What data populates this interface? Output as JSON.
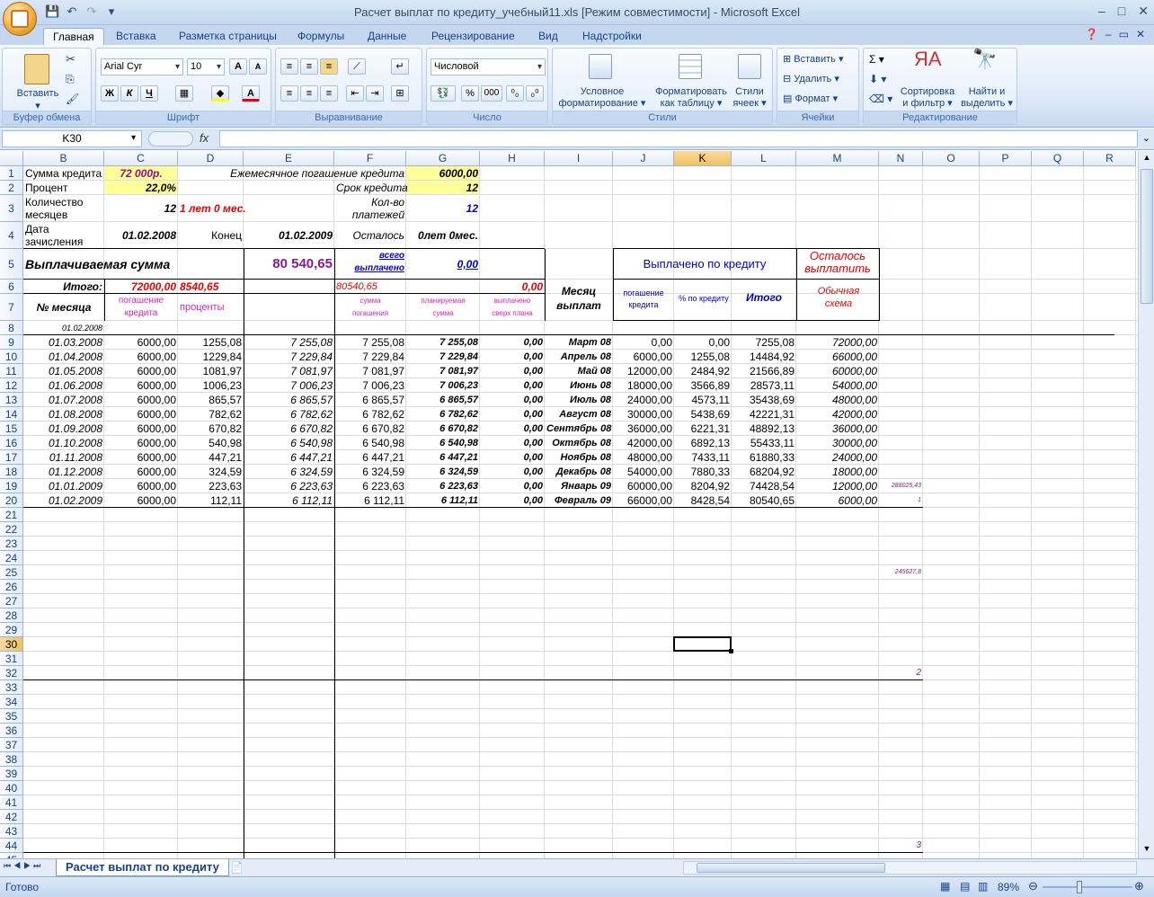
{
  "window": {
    "title": "Расчет выплат по кредиту_учебный11.xls  [Режим совместимости] - Microsoft Excel",
    "min": "–",
    "max": "□",
    "close": "✕"
  },
  "tabs": [
    "Главная",
    "Вставка",
    "Разметка страницы",
    "Формулы",
    "Данные",
    "Рецензирование",
    "Вид",
    "Надстройки"
  ],
  "ribbon": {
    "clipboard": {
      "label": "Буфер обмена",
      "paste": "Вставить"
    },
    "font": {
      "label": "Шрифт",
      "name": "Arial Cyr",
      "size": "10",
      "bold": "Ж",
      "italic": "К",
      "underline": "Ч"
    },
    "alignment": {
      "label": "Выравнивание"
    },
    "number": {
      "label": "Число",
      "format": "Числовой",
      "percent": "%",
      "thousands": "000"
    },
    "styles": {
      "label": "Стили",
      "cond1": "Условное",
      "cond2": "форматирование ▾",
      "table1": "Форматировать",
      "table2": "как таблицу ▾",
      "cell1": "Стили",
      "cell2": "ячеек ▾"
    },
    "cells": {
      "label": "Ячейки",
      "insert": "Вставить ▾",
      "delete": "Удалить ▾",
      "format": "Формат ▾"
    },
    "editing": {
      "label": "Редактирование",
      "sum": "Σ ▾",
      "sort1": "Сортировка",
      "sort2": "и фильтр ▾",
      "find1": "Найти и",
      "find2": "выделить ▾"
    }
  },
  "formula_bar": {
    "name_box": "K30",
    "fx": "fx",
    "value": ""
  },
  "columns": [
    "B",
    "C",
    "D",
    "E",
    "F",
    "G",
    "H",
    "I",
    "J",
    "K",
    "L",
    "M",
    "N",
    "O",
    "P",
    "Q",
    "R"
  ],
  "rows": [
    "1",
    "2",
    "3",
    "4",
    "5",
    "6",
    "7",
    "8",
    "9",
    "10",
    "11",
    "12",
    "13",
    "14",
    "15",
    "16",
    "17",
    "18",
    "19",
    "20",
    "21",
    "22",
    "23",
    "24",
    "25",
    "26",
    "27",
    "28",
    "29",
    "30",
    "31",
    "32",
    "33",
    "34",
    "35",
    "36",
    "37",
    "38",
    "39",
    "40",
    "41",
    "42",
    "43",
    "44",
    "45"
  ],
  "header": {
    "b1": "Сумма кредита",
    "c1": "72 000р.",
    "e1": "Ежемесячное погашение кредита",
    "g1": "6000,00",
    "b2": "Процент",
    "c2": "22,0%",
    "f2": "Срок кредита",
    "g2": "12",
    "b3a": "Количество",
    "b3b": "месяцев",
    "c3": "12",
    "d3": "1 лет 0 мес.",
    "f3a": "Кол-во",
    "f3b": "платежей",
    "g3": "12",
    "b4a": "Дата",
    "b4b": "зачисления",
    "c4": "01.02.2008",
    "d4": "Конец",
    "e4": "01.02.2009",
    "f4": "Осталось",
    "g4": "0лет 0мес.",
    "b5": "Выплачиваемая сумма",
    "e5": "80 540,65",
    "f5a": "всего",
    "f5b": "выплачено",
    "g5": "0,00",
    "j5": "Выплачено по кредиту",
    "m5a": "Осталось",
    "m5b": "выплатить",
    "b6": "Итого:",
    "c6": "72000,00",
    "d6": "8540,65",
    "f6": "80540,65",
    "h6": "0,00",
    "i6a": "Месяц",
    "i6b": "выплат",
    "j6a": "погашение",
    "j6b": "кредита",
    "k6": "% по кредиту",
    "l6": "Итого",
    "m6a": "Обычная",
    "m6b": "схема",
    "b7": "№ месяца",
    "c7a": "погашение",
    "c7b": "кредита",
    "d7": "проценты",
    "f7a": "сумма",
    "f7b": "погашения",
    "g7a": "планируемая",
    "g7b": "сумма",
    "h7a": "выплачено",
    "h7b": "сверх плана",
    "b8": "01.02.2008"
  },
  "table": [
    [
      "01.03.2008",
      "6000,00",
      "1255,08",
      "7 255,08",
      "7 255,08",
      "7 255,08",
      "0,00",
      "Март 08",
      "0,00",
      "0,00",
      "7255,08",
      "72000,00",
      ""
    ],
    [
      "01.04.2008",
      "6000,00",
      "1229,84",
      "7 229,84",
      "7 229,84",
      "7 229,84",
      "0,00",
      "Апрель 08",
      "6000,00",
      "1255,08",
      "14484,92",
      "66000,00",
      ""
    ],
    [
      "01.05.2008",
      "6000,00",
      "1081,97",
      "7 081,97",
      "7 081,97",
      "7 081,97",
      "0,00",
      "Май 08",
      "12000,00",
      "2484,92",
      "21566,89",
      "60000,00",
      ""
    ],
    [
      "01.06.2008",
      "6000,00",
      "1006,23",
      "7 006,23",
      "7 006,23",
      "7 006,23",
      "0,00",
      "Июнь 08",
      "18000,00",
      "3566,89",
      "28573,11",
      "54000,00",
      ""
    ],
    [
      "01.07.2008",
      "6000,00",
      "865,57",
      "6 865,57",
      "6 865,57",
      "6 865,57",
      "0,00",
      "Июль 08",
      "24000,00",
      "4573,11",
      "35438,69",
      "48000,00",
      ""
    ],
    [
      "01.08.2008",
      "6000,00",
      "782,62",
      "6 782,62",
      "6 782,62",
      "6 782,62",
      "0,00",
      "Август 08",
      "30000,00",
      "5438,69",
      "42221,31",
      "42000,00",
      ""
    ],
    [
      "01.09.2008",
      "6000,00",
      "670,82",
      "6 670,82",
      "6 670,82",
      "6 670,82",
      "0,00",
      "Сентябрь 08",
      "36000,00",
      "6221,31",
      "48892,13",
      "36000,00",
      ""
    ],
    [
      "01.10.2008",
      "6000,00",
      "540,98",
      "6 540,98",
      "6 540,98",
      "6 540,98",
      "0,00",
      "Октябрь 08",
      "42000,00",
      "6892,13",
      "55433,11",
      "30000,00",
      ""
    ],
    [
      "01.11.2008",
      "6000,00",
      "447,21",
      "6 447,21",
      "6 447,21",
      "6 447,21",
      "0,00",
      "Ноябрь 08",
      "48000,00",
      "7433,11",
      "61880,33",
      "24000,00",
      ""
    ],
    [
      "01.12.2008",
      "6000,00",
      "324,59",
      "6 324,59",
      "6 324,59",
      "6 324,59",
      "0,00",
      "Декабрь 08",
      "54000,00",
      "7880,33",
      "68204,92",
      "18000,00",
      ""
    ],
    [
      "01.01.2009",
      "6000,00",
      "223,63",
      "6 223,63",
      "6 223,63",
      "6 223,63",
      "0,00",
      "Январь 09",
      "60000,00",
      "8204,92",
      "74428,54",
      "12000,00",
      "288025,43"
    ],
    [
      "01.02.2009",
      "6000,00",
      "112,11",
      "6 112,11",
      "6 112,11",
      "6 112,11",
      "0,00",
      "Февраль 09",
      "66000,00",
      "8428,54",
      "80540,65",
      "6000,00",
      "1"
    ]
  ],
  "extra": {
    "n25": "245627,8",
    "n32": "2",
    "n44": "3"
  },
  "sheet_tab": "Расчет выплат по кредиту",
  "status": {
    "ready": "Готово",
    "zoom": "89%"
  }
}
